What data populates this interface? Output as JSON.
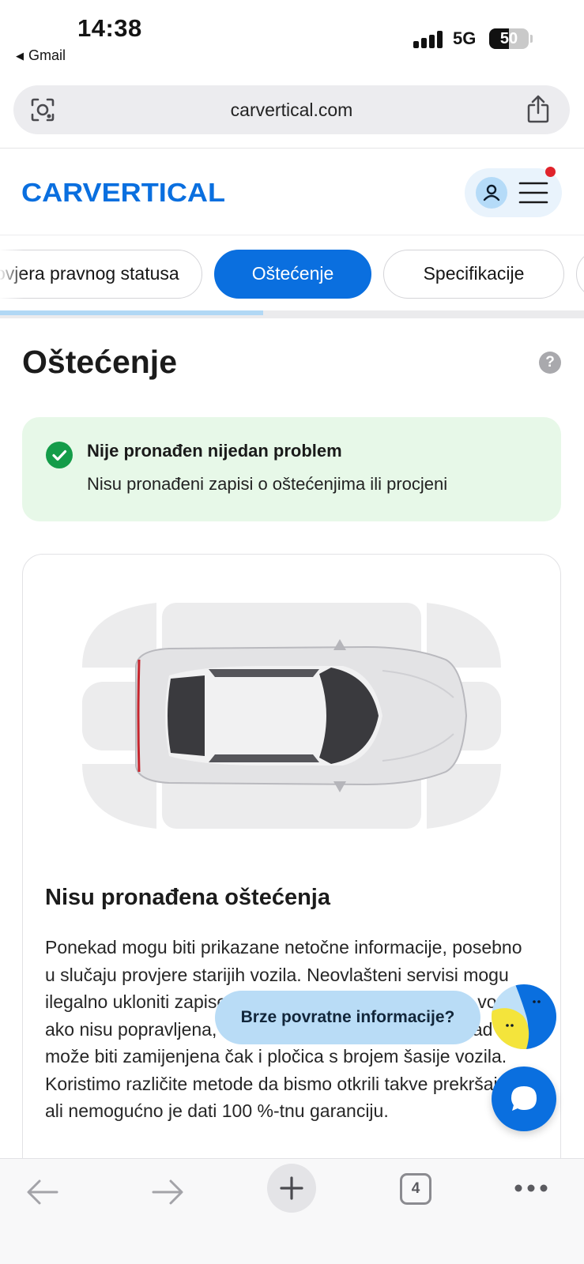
{
  "status_bar": {
    "time": "14:38",
    "back_app": "Gmail",
    "network": "5G",
    "battery": "50",
    "battery_level": 0.5
  },
  "browser": {
    "url": "carvertical.com",
    "open_tabs": "4"
  },
  "header": {
    "logo_text": "CARVERTICAL",
    "brand_color": "#0a6fdf",
    "notification_color": "#e0232b"
  },
  "tabs": [
    {
      "label": "Provjera pravnog statusa"
    },
    {
      "label": "Oštećenje",
      "active": true
    },
    {
      "label": "Specifikacije"
    }
  ],
  "scroll_progress": 0.45,
  "section": {
    "title": "Oštećenje",
    "help_label": "?"
  },
  "status_card": {
    "title": "Nije pronađen nijedan problem",
    "subtitle": "Nisu pronađeni zapisi o oštećenjima ili procjeni"
  },
  "damage_card": {
    "heading": "Nisu pronađena oštećenja",
    "body": "Ponekad mogu biti prikazane netočne informacije, posebno u slučaju provjere starijih vozila. Neovlašteni servisi mogu ilegalno ukloniti zapise o oštećenjima, a oštećenja na vozilu, ako nisu popravljena, možda nisu zabilježena. Ponekad može biti zamijenjena čak i pločica s brojem šasije vozila. Koristimo različite metode da bismo otkrili takve prekršaje, ali nemogućno je dati 100 %-tnu garanciju."
  },
  "floating": {
    "feedback_label": "Brze povratne informacije?"
  }
}
